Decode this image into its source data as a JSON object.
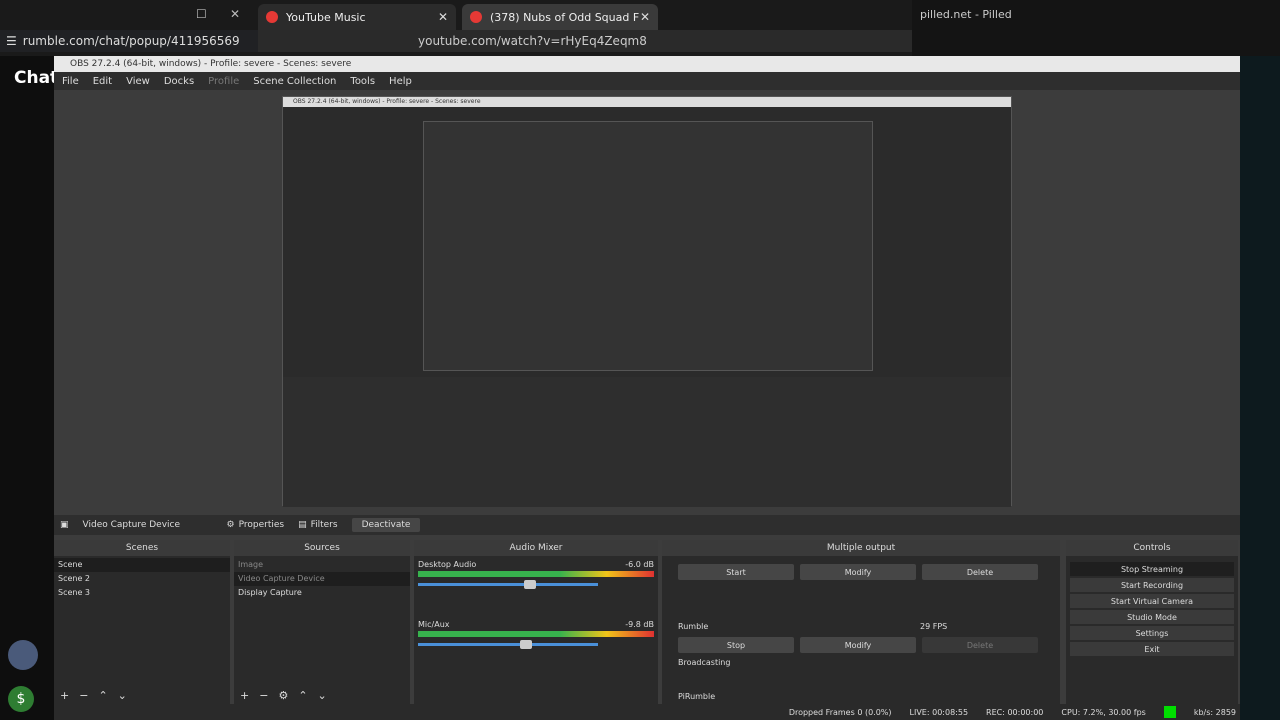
{
  "browser": {
    "tabs": [
      {
        "label": "YouTube Music"
      },
      {
        "label": "(378) Nubs of Odd Squad F"
      }
    ],
    "rumble_url": "rumble.com/chat/popup/411956569",
    "yt_url": "youtube.com/watch?v=rHyEq4Zeqm8",
    "pilled_title": "pilled.net - Pilled",
    "chat_heading": "Chat"
  },
  "obs": {
    "title": "OBS 27.2.4 (64-bit, windows) - Profile: severe - Scenes: severe",
    "menu": [
      "File",
      "Edit",
      "View",
      "Docks",
      "Profile",
      "Scene Collection",
      "Tools",
      "Help"
    ],
    "toolbar": {
      "source_name": "Video Capture Device",
      "properties": "Properties",
      "filters": "Filters",
      "deactivate": "Deactivate"
    },
    "scenes": {
      "title": "Scenes",
      "items": [
        "Scene",
        "Scene 2",
        "Scene 3"
      ]
    },
    "sources": {
      "title": "Sources",
      "items": [
        "Image",
        "Video Capture Device",
        "Display Capture"
      ]
    },
    "mixer": {
      "title": "Audio Mixer",
      "channels": [
        {
          "name": "Desktop Audio",
          "db": "-6.0 dB",
          "level": 0.62
        },
        {
          "name": "Mic/Aux",
          "db": "-9.8 dB",
          "level": 0.6
        }
      ]
    },
    "multi": {
      "title": "Multiple output",
      "start": "Start",
      "modify": "Modify",
      "delete": "Delete",
      "rumble": "Rumble",
      "fps": "29 FPS",
      "stop": "Stop",
      "broadcasting": "Broadcasting",
      "pirumble": "PiRumble"
    },
    "controls": {
      "title": "Controls",
      "items": [
        "Stop Streaming",
        "Start Recording",
        "Start Virtual Camera",
        "Studio Mode",
        "Settings",
        "Exit"
      ]
    },
    "status": {
      "dropped": "Dropped Frames 0 (0.0%)",
      "live": "LIVE: 00:08:55",
      "rec": "REC: 00:00:00",
      "cpu": "CPU: 7.2%, 30.00 fps",
      "kbs": "kb/s: 2859"
    }
  }
}
